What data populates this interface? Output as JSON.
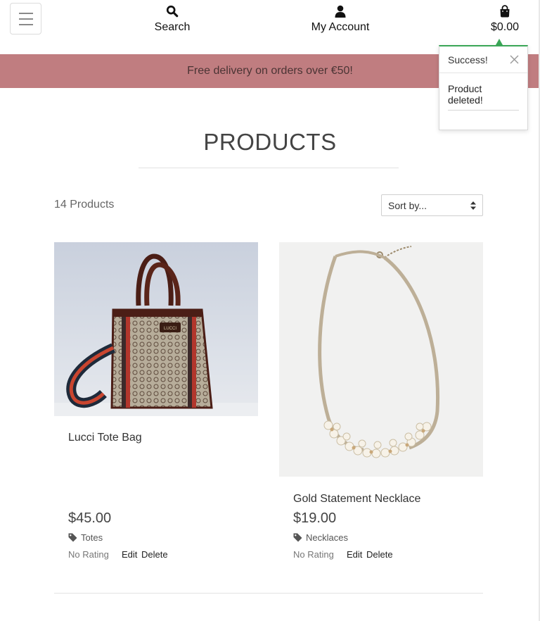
{
  "header": {
    "search_label": "Search",
    "account_label": "My Account",
    "bag_total": "$0.00"
  },
  "banner": {
    "text": "Free delivery on orders over €50!"
  },
  "toast": {
    "title": "Success!",
    "message": "Product deleted!"
  },
  "page": {
    "title": "PRODUCTS",
    "count": "14 Products",
    "sort_selected": "Sort by..."
  },
  "products": [
    {
      "name": "Lucci Tote Bag",
      "price": "$45.00",
      "category": "Totes",
      "rating": "No Rating",
      "edit": "Edit",
      "delete": "Delete"
    },
    {
      "name": "Gold Statement Necklace",
      "price": "$19.00",
      "category": "Necklaces",
      "rating": "No Rating",
      "edit": "Edit",
      "delete": "Delete"
    }
  ],
  "colors": {
    "banner": "#c07d80",
    "toast_accent": "#3aa657"
  }
}
